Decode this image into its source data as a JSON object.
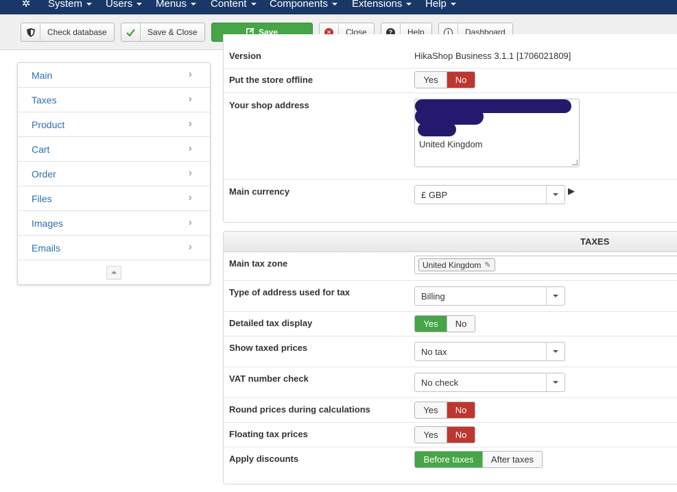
{
  "topmenu": {
    "items": [
      {
        "label": "System"
      },
      {
        "label": "Users"
      },
      {
        "label": "Menus"
      },
      {
        "label": "Content"
      },
      {
        "label": "Components"
      },
      {
        "label": "Extensions"
      },
      {
        "label": "Help"
      }
    ]
  },
  "toolbar": {
    "check_database": "Check database",
    "save_close": "Save & Close",
    "save": "Save",
    "close": "Close",
    "help": "Help",
    "dashboard": "Dashboard"
  },
  "sidebar": {
    "items": [
      {
        "label": "Main"
      },
      {
        "label": "Taxes"
      },
      {
        "label": "Product"
      },
      {
        "label": "Cart"
      },
      {
        "label": "Order"
      },
      {
        "label": "Files"
      },
      {
        "label": "Images"
      },
      {
        "label": "Emails"
      }
    ]
  },
  "main": {
    "version_label": "Version",
    "version_value": "HikaShop Business 3.1.1 [1706021809]",
    "offline_label": "Put the store offline",
    "offline": {
      "yes": "Yes",
      "no": "No",
      "selected": "No"
    },
    "address_label": "Your shop address",
    "address_visible": "United Kingdom",
    "currency_label": "Main currency",
    "currency_value": "£ GBP"
  },
  "taxes": {
    "header": "TAXES",
    "zone_label": "Main tax zone",
    "zone_tag": "United Kingdom",
    "address_type_label": "Type of address used for tax",
    "address_type_value": "Billing",
    "detailed_label": "Detailed tax display",
    "detailed": {
      "yes": "Yes",
      "no": "No",
      "selected": "Yes"
    },
    "show_taxed_label": "Show taxed prices",
    "show_taxed_value": "No tax",
    "vat_label": "VAT number check",
    "vat_value": "No check",
    "round_label": "Round prices during calculations",
    "round": {
      "yes": "Yes",
      "no": "No",
      "selected": "No"
    },
    "floating_label": "Floating tax prices",
    "floating": {
      "yes": "Yes",
      "no": "No",
      "selected": "No"
    },
    "discounts_label": "Apply discounts",
    "discounts": {
      "before": "Before taxes",
      "after": "After taxes",
      "selected": "Before taxes"
    }
  },
  "colors": {
    "navbar": "#1a3867",
    "save_green": "#46a546",
    "toggle_red": "#bd362f",
    "link_blue": "#2a6fb0",
    "redaction": "#231a6e"
  }
}
